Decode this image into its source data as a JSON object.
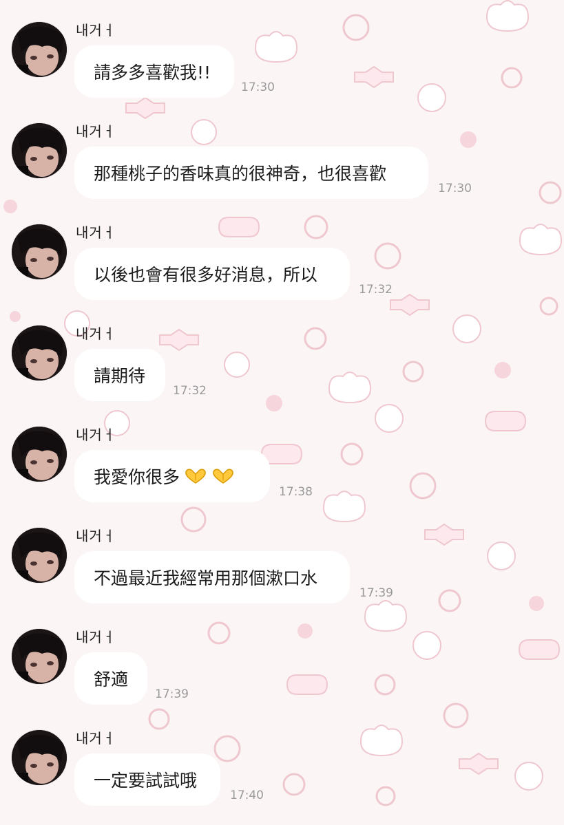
{
  "chat": {
    "messages": [
      {
        "sender": "내거ㅓ",
        "text": "請多多喜歡我!!",
        "time": "17:30"
      },
      {
        "sender": "내거ㅓ",
        "text": "那種桃子的香味真的很神奇，也很喜歡",
        "time": "17:30"
      },
      {
        "sender": "내거ㅓ",
        "text": "以後也會有很多好消息，所以",
        "time": "17:32"
      },
      {
        "sender": "내거ㅓ",
        "text": "請期待",
        "time": "17:32"
      },
      {
        "sender": "내거ㅓ",
        "text": "我愛你很多",
        "emoji": [
          "heart-hands-emoji",
          "heart-hands-emoji"
        ],
        "time": "17:38"
      },
      {
        "sender": "내거ㅓ",
        "text": "不過最近我經常用那個漱口水",
        "time": "17:39"
      },
      {
        "sender": "내거ㅓ",
        "text": "舒適",
        "time": "17:39"
      },
      {
        "sender": "내거ㅓ",
        "text": "一定要試試哦",
        "time": "17:40"
      }
    ]
  },
  "theme": {
    "background": "#fbf5f6",
    "bubble": "#ffffff",
    "wallpaper_accent": "#f2c6cf",
    "time_color": "#9a9a9a"
  }
}
